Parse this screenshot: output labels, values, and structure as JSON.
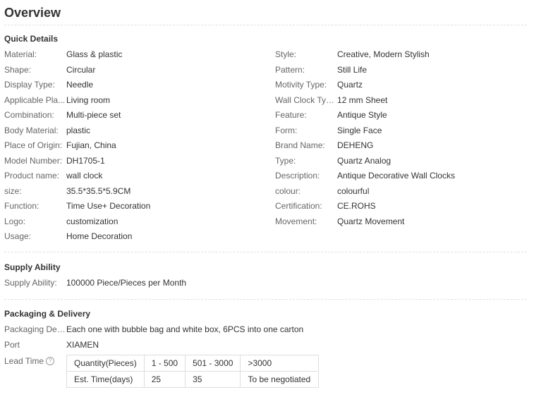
{
  "overview": {
    "title": "Overview"
  },
  "quick_details": {
    "title": "Quick Details",
    "left": [
      {
        "label": "Material:",
        "value": "Glass & plastic"
      },
      {
        "label": "Shape:",
        "value": "Circular"
      },
      {
        "label": "Display Type:",
        "value": "Needle"
      },
      {
        "label": "Applicable Pla...",
        "value": "Living room"
      },
      {
        "label": "Combination:",
        "value": "Multi-piece set"
      },
      {
        "label": "Body Material:",
        "value": "plastic"
      },
      {
        "label": "Place of Origin:",
        "value": "Fujian, China"
      },
      {
        "label": "Model Number:",
        "value": "DH1705-1"
      },
      {
        "label": "Product name:",
        "value": "wall clock"
      },
      {
        "label": "size:",
        "value": "35.5*35.5*5.9CM"
      },
      {
        "label": "Function:",
        "value": "Time Use+ Decoration"
      },
      {
        "label": "Logo:",
        "value": "customization"
      },
      {
        "label": "Usage:",
        "value": "Home Decoration"
      }
    ],
    "right": [
      {
        "label": "Style:",
        "value": "Creative, Modern Stylish"
      },
      {
        "label": "Pattern:",
        "value": "Still Life"
      },
      {
        "label": "Motivity Type:",
        "value": "Quartz"
      },
      {
        "label": "Wall Clock Type:",
        "value": "12 mm Sheet"
      },
      {
        "label": "Feature:",
        "value": "Antique Style"
      },
      {
        "label": "Form:",
        "value": "Single Face"
      },
      {
        "label": "Brand Name:",
        "value": "DEHENG"
      },
      {
        "label": "Type:",
        "value": "Quartz Analog"
      },
      {
        "label": "Description:",
        "value": "Antique Decorative Wall Clocks"
      },
      {
        "label": "colour:",
        "value": "colourful"
      },
      {
        "label": "Certification:",
        "value": "CE.ROHS"
      },
      {
        "label": "Movement:",
        "value": "Quartz Movement"
      }
    ]
  },
  "supply_ability": {
    "title": "Supply Ability",
    "label": "Supply Ability:",
    "value": "100000 Piece/Pieces per Month"
  },
  "packaging": {
    "title": "Packaging & Delivery",
    "details_label": "Packaging Det...",
    "details_value": "Each one with bubble bag and white box, 6PCS into one carton",
    "port_label": "Port",
    "port_value": "XIAMEN",
    "lead_time_label": "Lead Time",
    "help_icon": "question-circle-icon",
    "help_glyph": "?",
    "lead_table": {
      "rows": [
        [
          "Quantity(Pieces)",
          "1 - 500",
          "501 - 3000",
          ">3000"
        ],
        [
          "Est. Time(days)",
          "25",
          "35",
          "To be negotiated"
        ]
      ]
    }
  }
}
